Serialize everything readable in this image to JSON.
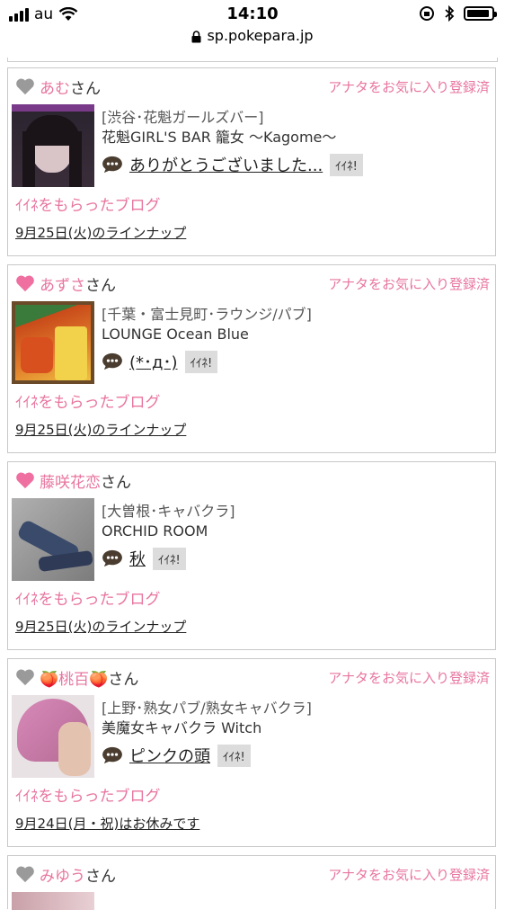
{
  "status_bar": {
    "carrier": "au",
    "time": "14:10"
  },
  "browser": {
    "url": "sp.pokepara.jp"
  },
  "cards": [
    {
      "name": "あむ",
      "suffix": "さん",
      "heart_color": "#9a9a9a",
      "fav_status": "アナタをお気に入り登録済",
      "shop_category": "[渋谷･花魁ガールズバー]",
      "shop_name": "花魁GIRL'S BAR 籠女 〜Kagome〜",
      "comment": "ありがとうございました...",
      "iine_label": "ｲｲﾈ!",
      "blog_link": "ｲｲﾈをもらったブログ",
      "lineup": "9月25日(火)のラインナップ"
    },
    {
      "name": "あずさ",
      "suffix": "さん",
      "heart_color": "#ee6fa0",
      "fav_status": "アナタをお気に入り登録済",
      "shop_category": "[千葉・富士見町･ラウンジ/パブ]",
      "shop_name": "LOUNGE Ocean Blue",
      "comment": "(*･д･)",
      "iine_label": "ｲｲﾈ!",
      "blog_link": "ｲｲﾈをもらったブログ",
      "lineup": "9月25日(火)のラインナップ"
    },
    {
      "name": "藤咲花恋",
      "suffix": "さん",
      "heart_color": "#ee6fa0",
      "fav_status": "",
      "shop_category": "[大曽根･キャバクラ]",
      "shop_name": "ORCHID ROOM",
      "comment": "秋",
      "iine_label": "ｲｲﾈ!",
      "blog_link": "ｲｲﾈをもらったブログ",
      "lineup": "9月25日(火)のラインナップ"
    },
    {
      "name": "🍑桃百🍑",
      "suffix": "さん",
      "heart_color": "#9a9a9a",
      "fav_status": "アナタをお気に入り登録済",
      "shop_category": "[上野･熟女パブ/熟女キャバクラ]",
      "shop_name": "美魔女キャバクラ Witch",
      "comment": "ピンクの頭",
      "iine_label": "ｲｲﾈ!",
      "blog_link": "ｲｲﾈをもらったブログ",
      "lineup": "9月24日(月・祝)はお休みです"
    },
    {
      "name": "みゆう",
      "suffix": "さん",
      "heart_color": "#9a9a9a",
      "fav_status": "アナタをお気に入り登録済"
    }
  ]
}
